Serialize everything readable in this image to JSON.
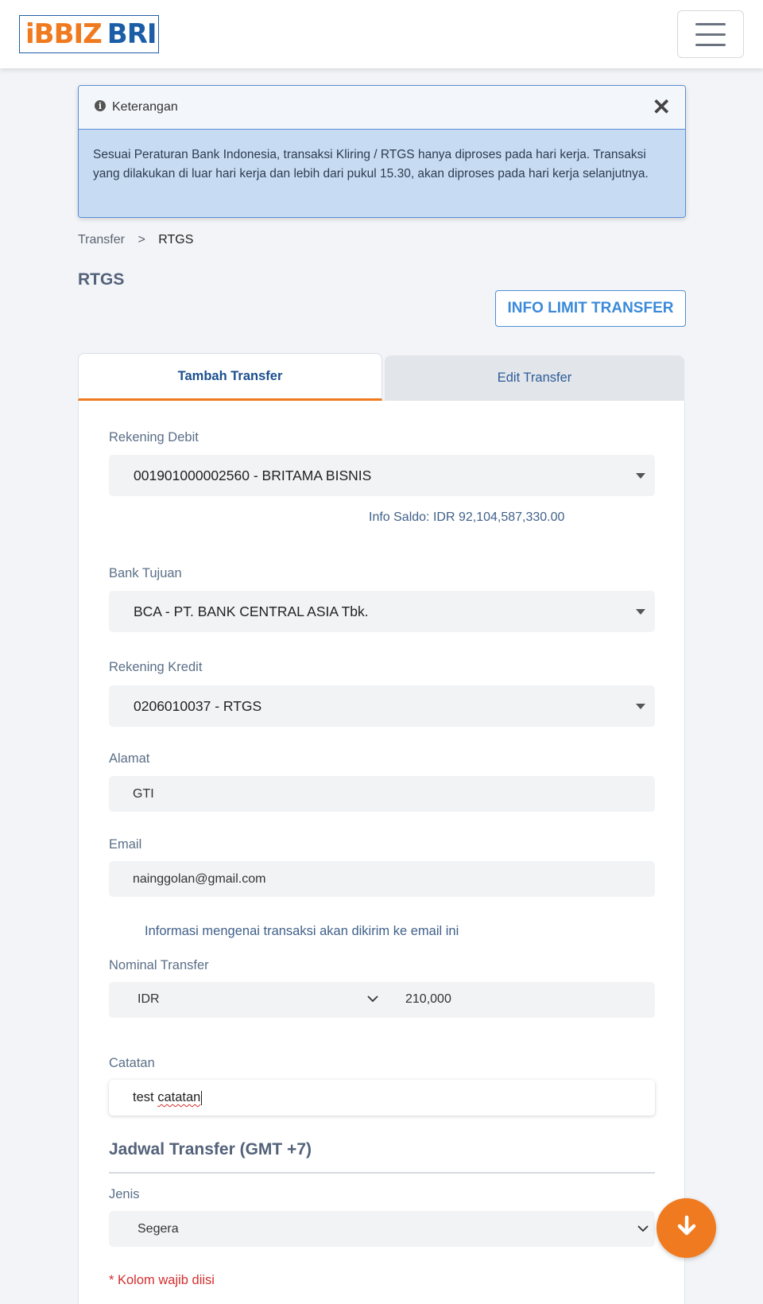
{
  "brand": {
    "logo_part1": "iBBIZ",
    "logo_part2": "BRI"
  },
  "alert": {
    "title": "Keterangan",
    "body": "Sesuai Peraturan Bank Indonesia, transaksi Kliring / RTGS hanya diproses pada hari kerja. Transaksi yang dilakukan di luar hari kerja dan lebih dari pukul 15.30, akan diproses pada hari kerja selanjutnya."
  },
  "breadcrumb": {
    "parent": "Transfer",
    "separator": ">",
    "current": "RTGS"
  },
  "page": {
    "title": "RTGS",
    "info_limit_button": "INFO LIMIT TRANSFER"
  },
  "tabs": [
    {
      "label": "Tambah Transfer",
      "active": true
    },
    {
      "label": "Edit Transfer",
      "active": false
    }
  ],
  "form": {
    "rekening_debit": {
      "label": "Rekening Debit",
      "value": "001901000002560 - BRITAMA BISNIS"
    },
    "info_saldo": "Info Saldo: IDR 92,104,587,330.00",
    "bank_tujuan": {
      "label": "Bank Tujuan",
      "value": "BCA - PT. BANK CENTRAL ASIA Tbk."
    },
    "rekening_kredit": {
      "label": "Rekening Kredit",
      "value": "0206010037 - RTGS"
    },
    "alamat": {
      "label": "Alamat",
      "value": "GTI"
    },
    "email": {
      "label": "Email",
      "value": "nainggolan@gmail.com",
      "note": "Informasi mengenai transaksi akan dikirim ke email ini"
    },
    "nominal": {
      "label": "Nominal Transfer",
      "currency": "IDR",
      "amount": "210,000"
    },
    "catatan": {
      "label": "Catatan",
      "value_plain": "test ",
      "value_misspelled": "catatan"
    },
    "jadwal": {
      "title": "Jadwal Transfer (GMT +7)",
      "jenis_label": "Jenis",
      "jenis_value": "Segera"
    },
    "required_note": "* Kolom wajib diisi"
  },
  "colors": {
    "brand_orange": "#f07a1f",
    "brand_blue": "#1b5ea7",
    "alert_bg": "#c7dcf3",
    "required_red": "#d32f2f"
  },
  "icons": [
    "info-icon",
    "close-icon",
    "hamburger-menu-icon",
    "caret-down-icon",
    "chevron-down-icon",
    "arrow-down-icon"
  ]
}
